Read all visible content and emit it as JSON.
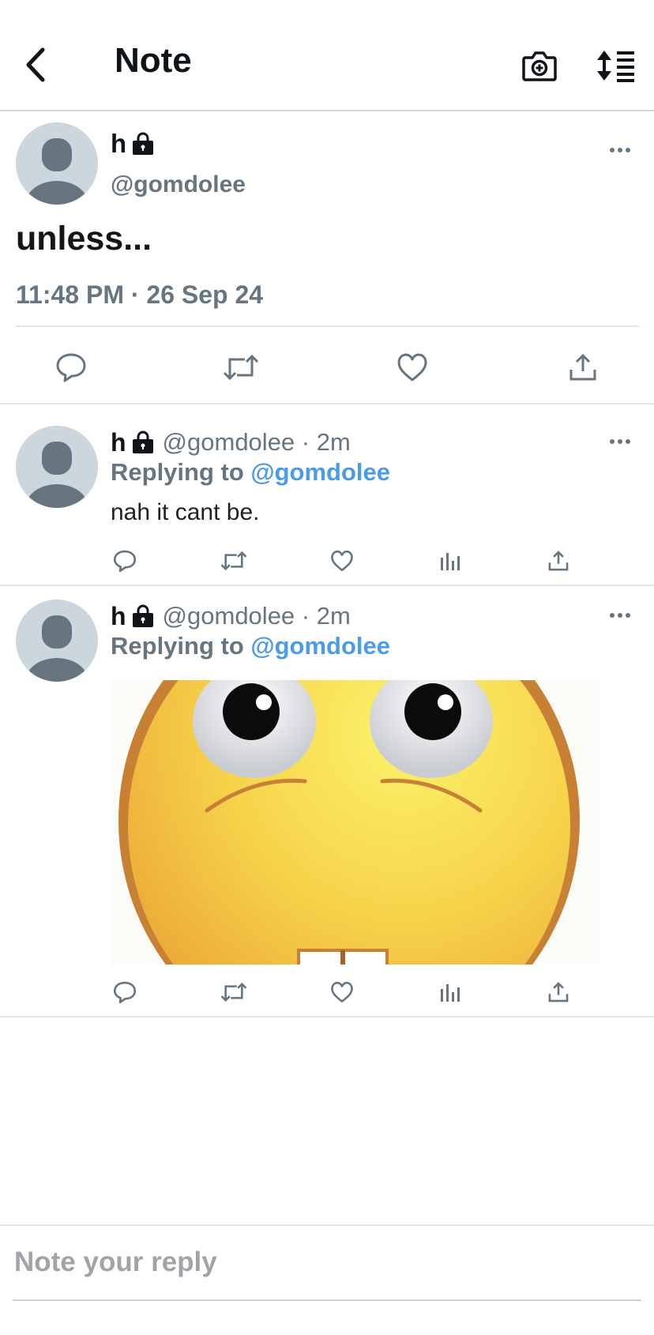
{
  "header": {
    "title": "Note",
    "back_icon": "chevron-left-icon",
    "camera_icon": "camera-plus-icon",
    "sort_icon": "sort-list-icon"
  },
  "main_post": {
    "name": "h",
    "handle": "@gomdolee",
    "text": "unless...",
    "timestamp": "11:48 PM · 26 Sep 24"
  },
  "replies": [
    {
      "name": "h",
      "meta": "@gomdolee · 2m",
      "replying_prefix": "Replying to ",
      "replying_handle": "@gomdolee",
      "text": "nah it cant be."
    },
    {
      "name": "h",
      "meta": "@gomdolee · 2m",
      "replying_prefix": "Replying to ",
      "replying_handle": "@gomdolee",
      "image": "rolling-eyes-emoji-image"
    }
  ],
  "composer": {
    "placeholder": "Note your reply"
  },
  "colors": {
    "link": "#4a9be8",
    "muted": "#66757f",
    "divider": "#e1e4e8",
    "avatar_bg": "#ccd6dd"
  }
}
